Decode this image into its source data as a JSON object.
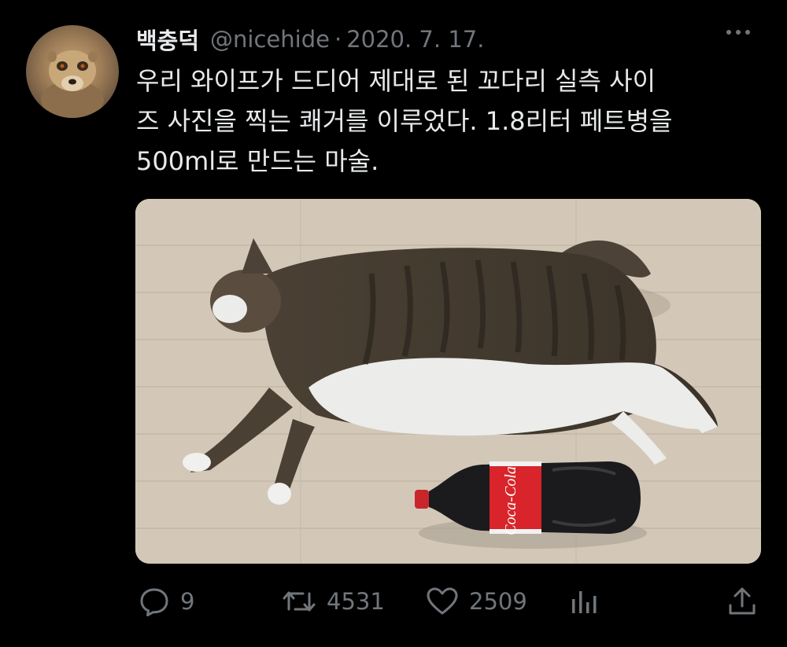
{
  "tweet": {
    "author_name": "백충덕",
    "handle": "@nicehide",
    "separator": "·",
    "date": "2020. 7. 17.",
    "text_lines": [
      "우리 와이프가 드디어 제대로 된 꼬다리 실측 사이",
      "즈 사진을 찍는 쾌거를 이루었다. 1.8리터 페트병을",
      "500ml로 만드는 마술."
    ]
  },
  "actions": {
    "replies": "9",
    "retweets": "4531",
    "likes": "2509"
  },
  "icons": {
    "more": "more-dots-icon",
    "reply": "reply-icon",
    "retweet": "retweet-icon",
    "like": "heart-icon",
    "views": "analytics-icon",
    "share": "share-icon"
  },
  "colors": {
    "background": "#000000",
    "text": "#e7e9ea",
    "muted": "#71767b"
  },
  "media": {
    "bottle_label_text": "Coca-Cola"
  }
}
